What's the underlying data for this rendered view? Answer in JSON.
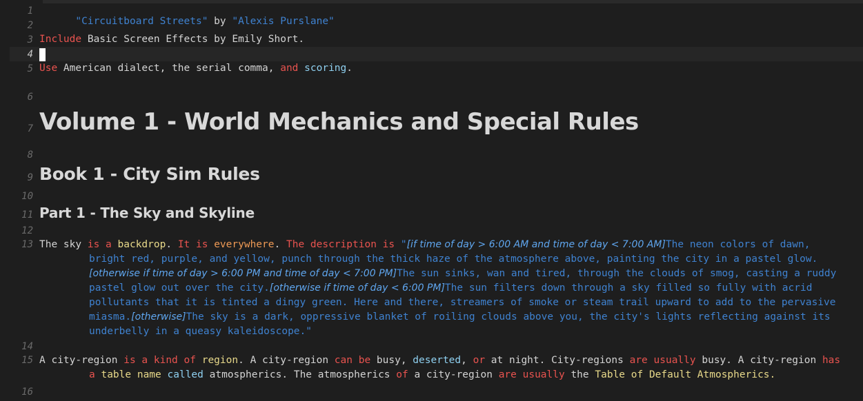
{
  "editor": {
    "line_numbers": [
      "1",
      "2",
      "3",
      "4",
      "5",
      "6",
      "7",
      "8",
      "9",
      "10",
      "11",
      "12",
      "13",
      "14",
      "15",
      "16"
    ],
    "l1": {
      "title": "\"Circuitboard Streets\"",
      "by": " by ",
      "author": "\"Alexis Purslane\""
    },
    "l3": {
      "include": "Include",
      "rest": " Basic Screen Effects by Emily Short."
    },
    "l5": {
      "use": "Use",
      "mid": " American dialect, the serial comma, ",
      "and": "and",
      "scoring": "scoring",
      "dot": "."
    },
    "l7": {
      "heading": "Volume 1 - World Mechanics and Special Rules"
    },
    "l9": {
      "heading": "Book 1 - City Sim Rules"
    },
    "l11": {
      "heading": "Part 1 - The Sky and Skyline"
    },
    "l13": {
      "the_sky": "The sky ",
      "is_a": "is a ",
      "backdrop": "backdrop",
      "dot1": ". ",
      "it_is": "It is ",
      "everywhere": "everywhere",
      "dot2": ". ",
      "the_description_is": "The description is ",
      "q_open": "\"",
      "sub1": "[if time of day > 6:00 AM and time of day < 7:00 AM]",
      "text1": "The neon colors of dawn, bright red, purple, and yellow, punch through the thick haze of the atmosphere above, painting the city in a pastel glow.",
      "sub2": "[otherwise if time of day > 6:00 PM and time of day < 7:00 PM]",
      "text2": "The sun sinks, wan and tired, through the clouds of smog, casting a ruddy pastel glow out over the city.",
      "sub3": "[otherwise if time of day < 6:00 PM]",
      "text3": "The sun filters down through a sky filled so fully with acrid pollutants that it is tinted a dingy green. Here and there, streamers of smoke or steam trail upward to add to the pervasive miasma.",
      "sub4": "[otherwise]",
      "text4": "The sky is a dark, oppressive blanket of roiling clouds above you, the city's lights reflecting against its underbelly in a queasy kaleidoscope.\""
    },
    "l15": {
      "a_city_region": "A city-region ",
      "is_a_kind_of": "is a kind of ",
      "region": "region",
      "p1": ". A city-region ",
      "can_be": "can be",
      "p2": " busy, ",
      "deserted": "deserted",
      "p3": ", ",
      "or": "or",
      "p4": " at night. City-regions ",
      "are_usually": "are usually",
      "p5": " busy. A city-region ",
      "has_a": "has a ",
      "table_name": "table name",
      "sp": " ",
      "called": "called",
      "p6": " atmospherics. The atmospherics ",
      "of": "of",
      "p7": " a city-region ",
      "are_usually2": "are usually",
      "p8": " the ",
      "table_ref": "Table of Default Atmospherics."
    }
  },
  "colors": {
    "background": "#1e1e1e",
    "string": "#3f82d0",
    "keyword": "#e9534f",
    "type": "#ef9a55",
    "noun": "#e8d98a",
    "property": "#8fd0f0",
    "substitution": "#5fa6ef"
  }
}
